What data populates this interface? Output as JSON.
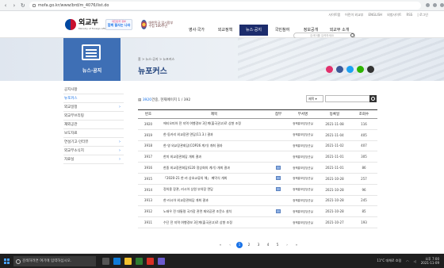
{
  "browser": {
    "url": "mofa.go.kr/www/brd/m_4076/list.do"
  },
  "utility": [
    "사이트맵",
    "어린이 외교부",
    "ENGLISH",
    "외청사이트",
    "RSS",
    "| 로그인"
  ],
  "header": {
    "logo_ko": "외교부",
    "logo_en": "Ministry of Foreign Affairs",
    "badge1_top": "대한민국 정부",
    "badge1_main": "함께 잘사는 나라",
    "badge2_text": "대한민국 임시정부 수립 100주년",
    "gnb": [
      "영사·국가",
      "외교정책",
      "뉴스·공지",
      "국민참여",
      "정보공개",
      "외교부 소개"
    ],
    "active_gnb_index": 2,
    "search_placeholder": "검색어를 입력하세요"
  },
  "banner": {
    "side_title": "뉴스·공지",
    "breadcrumb": "홈 > 뉴스·공지 > 뉴포커스",
    "page_title": "뉴포커스"
  },
  "sidebar": {
    "items": [
      {
        "label": "공지사항",
        "chev": false
      },
      {
        "label": "뉴포커스",
        "chev": false,
        "active": true
      },
      {
        "label": "외교일정",
        "chev": true
      },
      {
        "label": "외교부브리핑",
        "chev": false
      },
      {
        "label": "재외공관",
        "chev": false
      },
      {
        "label": "보도자료",
        "chev": false
      },
      {
        "label": "연설기고·인터뷰",
        "chev": true
      },
      {
        "label": "외교부소식지",
        "chev": true
      },
      {
        "label": "자료실",
        "chev": true
      }
    ]
  },
  "content": {
    "count_num": "3920",
    "count_rest": "건중, 현재페이지 1 / 392",
    "select_value": "제목",
    "columns": [
      "번호",
      "제목",
      "첨부",
      "부서명",
      "등록일",
      "조회수"
    ],
    "rows": [
      {
        "no": "3920",
        "title": "에티오피아 전 지역 여행경보 3단계(출국권고)로 상향 조정",
        "attach": false,
        "dept": "정책홍보담당관실",
        "date": "2021-11-08",
        "views": "116"
      },
      {
        "no": "3919",
        "title": "한-동카리 외교장관 면담(11.3.) 결과",
        "attach": false,
        "dept": "정책홍보담당관실",
        "date": "2021-11-04",
        "views": "405"
      },
      {
        "no": "3918",
        "title": "한-영 외교장관회담(COP26 계기) 개최 결과",
        "attach": false,
        "dept": "정책홍보담당관실",
        "date": "2021-11-02",
        "views": "407"
      },
      {
        "no": "3917",
        "title": "한미 외교장관회담 개최 결과",
        "attach": false,
        "dept": "정책홍보담당관실",
        "date": "2021-11-01",
        "views": "305"
      },
      {
        "no": "3916",
        "title": "한중 외교장관회담(G20 정상회의 계기) 개최 결과",
        "attach": true,
        "dept": "정책홍보담당관실",
        "date": "2021-11-01",
        "views": "86"
      },
      {
        "no": "3915",
        "title": "「2020-21 한-카 상호교류의 해」 폐막식 개최",
        "attach": true,
        "dept": "정책홍보담당관실",
        "date": "2021-10-28",
        "views": "257"
      },
      {
        "no": "3914",
        "title": "정의용 장관, 러시아 상원 부의장 면담",
        "attach": true,
        "dept": "정책홍보담당관실",
        "date": "2021-10-28",
        "views": "96"
      },
      {
        "no": "3913",
        "title": "한-러시아 외교장관회담 개최 결과",
        "attach": false,
        "dept": "정책홍보담당관실",
        "date": "2021-10-28",
        "views": "245"
      },
      {
        "no": "3912",
        "title": "노태우 전 대통령 국가장 관련 재외공관 조문소 설치",
        "attach": true,
        "dept": "정책홍보담당관실",
        "date": "2021-10-28",
        "views": "85"
      },
      {
        "no": "3911",
        "title": "수단 전 지역 여행경보 3단계(출국권고)로 상향 조정",
        "attach": false,
        "dept": "정책홍보담당관실",
        "date": "2021-10-27",
        "views": "193"
      }
    ]
  },
  "pagination": {
    "pages": [
      "1",
      "2",
      "3",
      "4",
      "5"
    ],
    "current": "1",
    "first": "«",
    "prev": "‹",
    "next": "›",
    "last": "»"
  },
  "taskbar": {
    "search_placeholder": "검색하려면 여기에 입력하십시오.",
    "weather": "11°C 대체로 흐림",
    "time": "오후 7:00",
    "date": "2021-11-09"
  },
  "colors": {
    "brand_navy": "#1c2c6c",
    "accent_blue": "#3e6fb5",
    "link_blue": "#1a73e8"
  }
}
